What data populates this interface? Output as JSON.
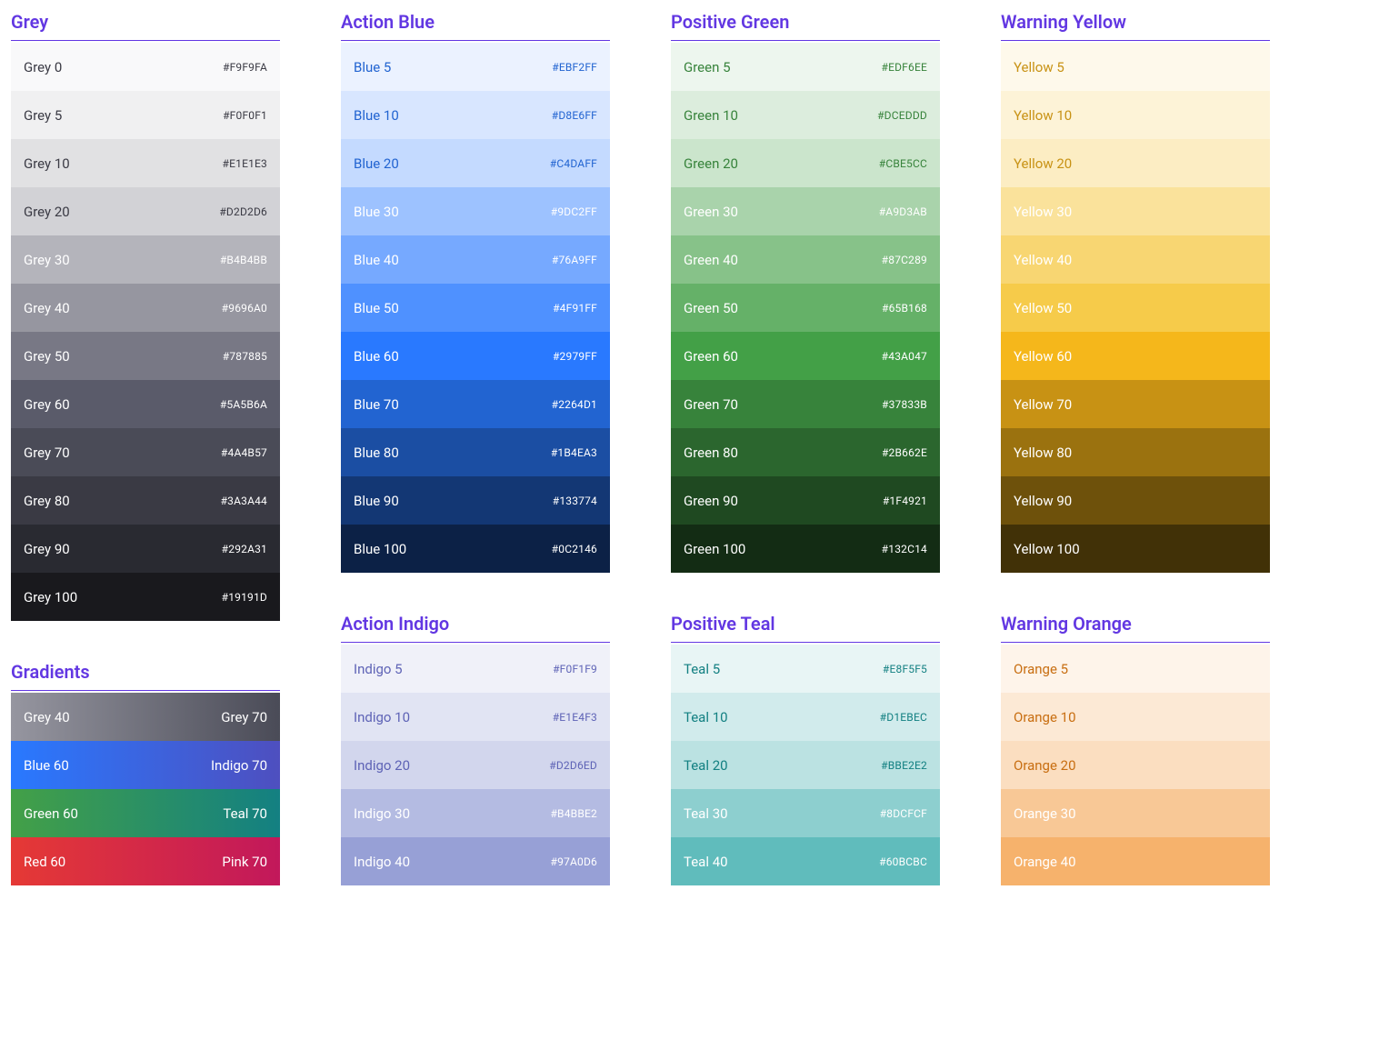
{
  "columns": [
    [
      {
        "title": "Grey",
        "swatches": [
          {
            "label": "Grey 0",
            "hex": "#F9F9FA",
            "bg": "#F9F9FA",
            "fg": "#3A3A44",
            "hexfg": "#3A3A44"
          },
          {
            "label": "Grey 5",
            "hex": "#F0F0F1",
            "bg": "#F0F0F1",
            "fg": "#3A3A44",
            "hexfg": "#3A3A44"
          },
          {
            "label": "Grey 10",
            "hex": "#E1E1E3",
            "bg": "#E1E1E3",
            "fg": "#3A3A44",
            "hexfg": "#3A3A44"
          },
          {
            "label": "Grey 20",
            "hex": "#D2D2D6",
            "bg": "#D2D2D6",
            "fg": "#3A3A44",
            "hexfg": "#3A3A44"
          },
          {
            "label": "Grey 30",
            "hex": "#B4B4BB",
            "bg": "#B4B4BB",
            "fg": "#FFFFFF",
            "hexfg": "#FFFFFF"
          },
          {
            "label": "Grey 40",
            "hex": "#9696A0",
            "bg": "#9696A0",
            "fg": "#FFFFFF",
            "hexfg": "#FFFFFF"
          },
          {
            "label": "Grey 50",
            "hex": "#787885",
            "bg": "#787885",
            "fg": "#FFFFFF",
            "hexfg": "#FFFFFF"
          },
          {
            "label": "Grey 60",
            "hex": "#5A5B6A",
            "bg": "#5A5B6A",
            "fg": "#FFFFFF",
            "hexfg": "#FFFFFF"
          },
          {
            "label": "Grey 70",
            "hex": "#4A4B57",
            "bg": "#4A4B57",
            "fg": "#FFFFFF",
            "hexfg": "#FFFFFF"
          },
          {
            "label": "Grey 80",
            "hex": "#3A3A44",
            "bg": "#3A3A44",
            "fg": "#FFFFFF",
            "hexfg": "#FFFFFF"
          },
          {
            "label": "Grey 90",
            "hex": "#292A31",
            "bg": "#292A31",
            "fg": "#FFFFFF",
            "hexfg": "#FFFFFF"
          },
          {
            "label": "Grey 100",
            "hex": "#19191D",
            "bg": "#19191D",
            "fg": "#FFFFFF",
            "hexfg": "#FFFFFF"
          }
        ]
      },
      {
        "title": "Gradients",
        "gradients": [
          {
            "left": "Grey 40",
            "right": "Grey 70",
            "from": "#9696A0",
            "to": "#4A4B57"
          },
          {
            "left": "Blue 60",
            "right": "Indigo 70",
            "from": "#2979FF",
            "to": "#4E4FBF"
          },
          {
            "left": "Green 60",
            "right": "Teal 70",
            "from": "#43A047",
            "to": "#138082"
          },
          {
            "left": "Red 60",
            "right": "Pink 70",
            "from": "#E53935",
            "to": "#C2185B"
          }
        ]
      }
    ],
    [
      {
        "title": "Action Blue",
        "swatches": [
          {
            "label": "Blue 5",
            "hex": "#EBF2FF",
            "bg": "#EBF2FF",
            "fg": "#2264D1",
            "hexfg": "#2264D1"
          },
          {
            "label": "Blue 10",
            "hex": "#D8E6FF",
            "bg": "#D8E6FF",
            "fg": "#2264D1",
            "hexfg": "#2264D1"
          },
          {
            "label": "Blue 20",
            "hex": "#C4DAFF",
            "bg": "#C4DAFF",
            "fg": "#2264D1",
            "hexfg": "#2264D1"
          },
          {
            "label": "Blue 30",
            "hex": "#9DC2FF",
            "bg": "#9DC2FF",
            "fg": "#FFFFFF",
            "hexfg": "#FFFFFF"
          },
          {
            "label": "Blue 40",
            "hex": "#76A9FF",
            "bg": "#76A9FF",
            "fg": "#FFFFFF",
            "hexfg": "#FFFFFF"
          },
          {
            "label": "Blue 50",
            "hex": "#4F91FF",
            "bg": "#4F91FF",
            "fg": "#FFFFFF",
            "hexfg": "#FFFFFF"
          },
          {
            "label": "Blue 60",
            "hex": "#2979FF",
            "bg": "#2979FF",
            "fg": "#FFFFFF",
            "hexfg": "#FFFFFF"
          },
          {
            "label": "Blue 70",
            "hex": "#2264D1",
            "bg": "#2264D1",
            "fg": "#FFFFFF",
            "hexfg": "#FFFFFF"
          },
          {
            "label": "Blue 80",
            "hex": "#1B4EA3",
            "bg": "#1B4EA3",
            "fg": "#FFFFFF",
            "hexfg": "#FFFFFF"
          },
          {
            "label": "Blue 90",
            "hex": "#133774",
            "bg": "#133774",
            "fg": "#FFFFFF",
            "hexfg": "#FFFFFF"
          },
          {
            "label": "Blue 100",
            "hex": "#0C2146",
            "bg": "#0C2146",
            "fg": "#FFFFFF",
            "hexfg": "#FFFFFF"
          }
        ]
      },
      {
        "title": "Action Indigo",
        "swatches": [
          {
            "label": "Indigo 5",
            "hex": "#F0F1F9",
            "bg": "#F0F1F9",
            "fg": "#5E63B6",
            "hexfg": "#5E63B6"
          },
          {
            "label": "Indigo 10",
            "hex": "#E1E4F3",
            "bg": "#E1E4F3",
            "fg": "#5E63B6",
            "hexfg": "#5E63B6"
          },
          {
            "label": "Indigo 20",
            "hex": "#D2D6ED",
            "bg": "#D2D6ED",
            "fg": "#5E63B6",
            "hexfg": "#5E63B6"
          },
          {
            "label": "Indigo 30",
            "hex": "#B4BBE2",
            "bg": "#B4BBE2",
            "fg": "#FFFFFF",
            "hexfg": "#FFFFFF"
          },
          {
            "label": "Indigo 40",
            "hex": "#97A0D6",
            "bg": "#97A0D6",
            "fg": "#FFFFFF",
            "hexfg": "#FFFFFF"
          }
        ]
      }
    ],
    [
      {
        "title": "Positive Green",
        "swatches": [
          {
            "label": "Green 5",
            "hex": "#EDF6EE",
            "bg": "#EDF6EE",
            "fg": "#37833B",
            "hexfg": "#37833B"
          },
          {
            "label": "Green 10",
            "hex": "#DCEDDD",
            "bg": "#DCEDDD",
            "fg": "#37833B",
            "hexfg": "#37833B"
          },
          {
            "label": "Green 20",
            "hex": "#CBE5CC",
            "bg": "#CBE5CC",
            "fg": "#37833B",
            "hexfg": "#37833B"
          },
          {
            "label": "Green 30",
            "hex": "#A9D3AB",
            "bg": "#A9D3AB",
            "fg": "#FFFFFF",
            "hexfg": "#FFFFFF"
          },
          {
            "label": "Green 40",
            "hex": "#87C289",
            "bg": "#87C289",
            "fg": "#FFFFFF",
            "hexfg": "#FFFFFF"
          },
          {
            "label": "Green 50",
            "hex": "#65B168",
            "bg": "#65B168",
            "fg": "#FFFFFF",
            "hexfg": "#FFFFFF"
          },
          {
            "label": "Green 60",
            "hex": "#43A047",
            "bg": "#43A047",
            "fg": "#FFFFFF",
            "hexfg": "#FFFFFF"
          },
          {
            "label": "Green 70",
            "hex": "#37833B",
            "bg": "#37833B",
            "fg": "#FFFFFF",
            "hexfg": "#FFFFFF"
          },
          {
            "label": "Green 80",
            "hex": "#2B662E",
            "bg": "#2B662E",
            "fg": "#FFFFFF",
            "hexfg": "#FFFFFF"
          },
          {
            "label": "Green 90",
            "hex": "#1F4921",
            "bg": "#1F4921",
            "fg": "#FFFFFF",
            "hexfg": "#FFFFFF"
          },
          {
            "label": "Green 100",
            "hex": "#132C14",
            "bg": "#132C14",
            "fg": "#FFFFFF",
            "hexfg": "#FFFFFF"
          }
        ]
      },
      {
        "title": "Positive Teal",
        "swatches": [
          {
            "label": "Teal 5",
            "hex": "#E8F5F5",
            "bg": "#E8F5F5",
            "fg": "#138082",
            "hexfg": "#138082"
          },
          {
            "label": "Teal 10",
            "hex": "#D1EBEC",
            "bg": "#D1EBEC",
            "fg": "#138082",
            "hexfg": "#138082"
          },
          {
            "label": "Teal 20",
            "hex": "#BBE2E2",
            "bg": "#BBE2E2",
            "fg": "#138082",
            "hexfg": "#138082"
          },
          {
            "label": "Teal 30",
            "hex": "#8DCFCF",
            "bg": "#8DCFCF",
            "fg": "#FFFFFF",
            "hexfg": "#FFFFFF"
          },
          {
            "label": "Teal 40",
            "hex": "#60BCBC",
            "bg": "#60BCBC",
            "fg": "#FFFFFF",
            "hexfg": "#FFFFFF"
          }
        ]
      }
    ],
    [
      {
        "title": "Warning Yellow",
        "swatches": [
          {
            "label": "Yellow 5",
            "hex": "",
            "bg": "#FEF9EB",
            "fg": "#C89214",
            "hexfg": ""
          },
          {
            "label": "Yellow 10",
            "hex": "",
            "bg": "#FDF3D7",
            "fg": "#C89214",
            "hexfg": ""
          },
          {
            "label": "Yellow 20",
            "hex": "",
            "bg": "#FCEDC3",
            "fg": "#C89214",
            "hexfg": ""
          },
          {
            "label": "Yellow 30",
            "hex": "",
            "bg": "#FAE29B",
            "fg": "#FFFFFF",
            "hexfg": ""
          },
          {
            "label": "Yellow 40",
            "hex": "",
            "bg": "#F8D672",
            "fg": "#FFFFFF",
            "hexfg": ""
          },
          {
            "label": "Yellow 50",
            "hex": "",
            "bg": "#F6CB4A",
            "fg": "#FFFFFF",
            "hexfg": ""
          },
          {
            "label": "Yellow 60",
            "hex": "",
            "bg": "#F5B71B",
            "fg": "#FFFFFF",
            "hexfg": ""
          },
          {
            "label": "Yellow 70",
            "hex": "",
            "bg": "#C89214",
            "fg": "#FFFFFF",
            "hexfg": ""
          },
          {
            "label": "Yellow 80",
            "hex": "",
            "bg": "#9B720F",
            "fg": "#FFFFFF",
            "hexfg": ""
          },
          {
            "label": "Yellow 90",
            "hex": "",
            "bg": "#6E510B",
            "fg": "#FFFFFF",
            "hexfg": ""
          },
          {
            "label": "Yellow 100",
            "hex": "",
            "bg": "#413107",
            "fg": "#FFFFFF",
            "hexfg": ""
          }
        ]
      },
      {
        "title": "Warning Orange",
        "swatches": [
          {
            "label": "Orange 5",
            "hex": "",
            "bg": "#FEF4EA",
            "fg": "#C86E11",
            "hexfg": ""
          },
          {
            "label": "Orange 10",
            "hex": "",
            "bg": "#FCE9D5",
            "fg": "#C86E11",
            "hexfg": ""
          },
          {
            "label": "Orange 20",
            "hex": "",
            "bg": "#FBDEC0",
            "fg": "#C86E11",
            "hexfg": ""
          },
          {
            "label": "Orange 30",
            "hex": "",
            "bg": "#F8C896",
            "fg": "#FFFFFF",
            "hexfg": ""
          },
          {
            "label": "Orange 40",
            "hex": "",
            "bg": "#F6B26C",
            "fg": "#FFFFFF",
            "hexfg": ""
          }
        ]
      }
    ]
  ]
}
